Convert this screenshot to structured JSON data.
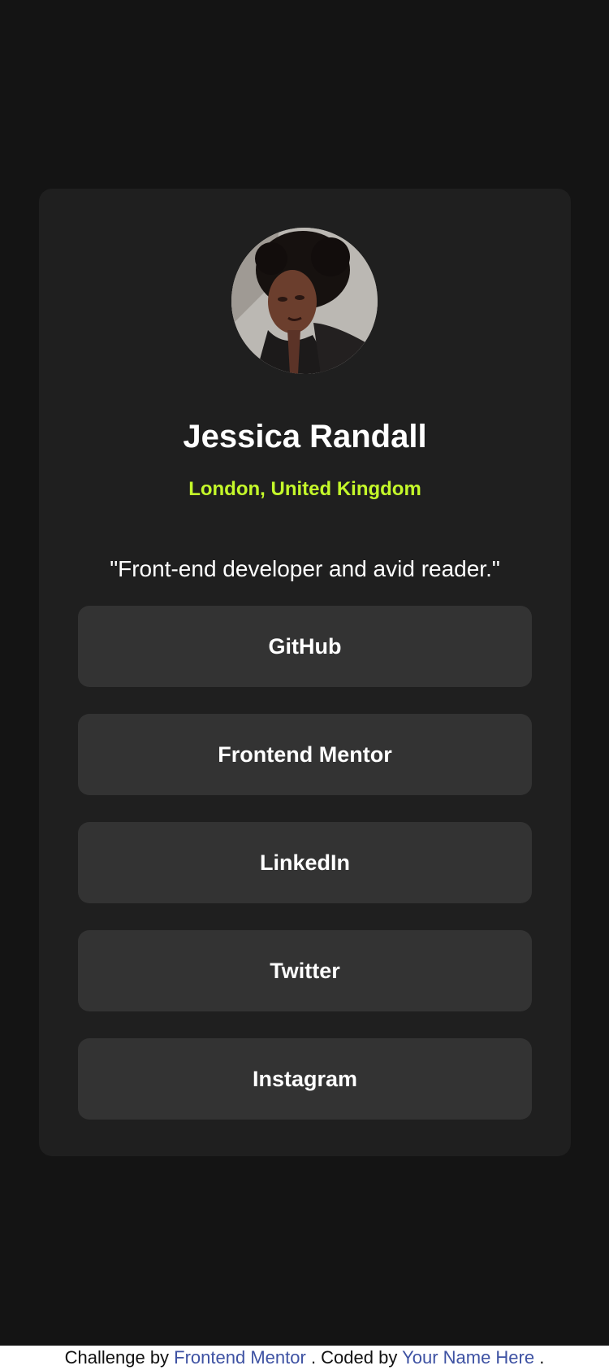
{
  "profile": {
    "name": "Jessica Randall",
    "location": "London, United Kingdom",
    "bio": "\"Front-end developer and avid reader.\""
  },
  "links": [
    {
      "label": "GitHub"
    },
    {
      "label": "Frontend Mentor"
    },
    {
      "label": "LinkedIn"
    },
    {
      "label": "Twitter"
    },
    {
      "label": "Instagram"
    }
  ],
  "footer": {
    "prefix": "Challenge by ",
    "challenge_link": "Frontend Mentor",
    "middle": ". Coded by ",
    "author_link": "Your Name Here",
    "suffix": "."
  },
  "colors": {
    "background": "#141414",
    "card": "#1f1f1f",
    "button": "#333333",
    "accent": "#c4f82a",
    "text": "#ffffff",
    "link": "#3e52a3"
  }
}
